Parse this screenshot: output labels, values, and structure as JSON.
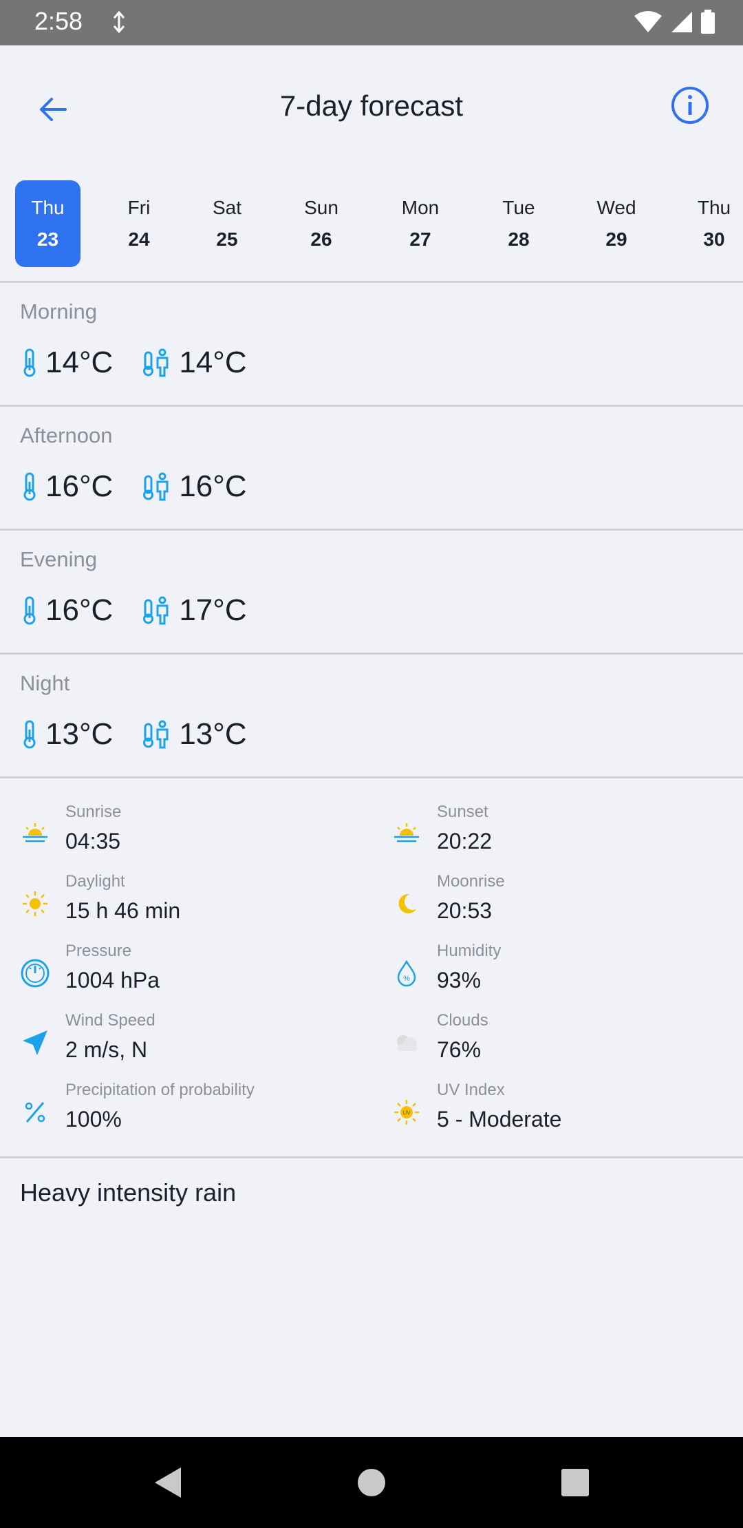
{
  "status_bar": {
    "time": "2:58"
  },
  "app_bar": {
    "title": "7-day forecast"
  },
  "days": [
    {
      "name": "Thu",
      "num": "23",
      "selected": true
    },
    {
      "name": "Fri",
      "num": "24"
    },
    {
      "name": "Sat",
      "num": "25"
    },
    {
      "name": "Sun",
      "num": "26"
    },
    {
      "name": "Mon",
      "num": "27"
    },
    {
      "name": "Tue",
      "num": "28"
    },
    {
      "name": "Wed",
      "num": "29"
    },
    {
      "name": "Thu",
      "num": "30"
    }
  ],
  "periods": [
    {
      "label": "Morning",
      "temp": "14°C",
      "feels_like": "14°C"
    },
    {
      "label": "Afternoon",
      "temp": "16°C",
      "feels_like": "16°C"
    },
    {
      "label": "Evening",
      "temp": "16°C",
      "feels_like": "17°C"
    },
    {
      "label": "Night",
      "temp": "13°C",
      "feels_like": "13°C"
    }
  ],
  "details": {
    "sunrise": {
      "label": "Sunrise",
      "value": "04:35",
      "icon": "sunrise-icon"
    },
    "sunset": {
      "label": "Sunset",
      "value": "20:22",
      "icon": "sunset-icon"
    },
    "daylight": {
      "label": "Daylight",
      "value": "15 h 46 min",
      "icon": "sun-icon"
    },
    "moonrise": {
      "label": "Moonrise",
      "value": "20:53",
      "icon": "moon-icon"
    },
    "pressure": {
      "label": "Pressure",
      "value": "1004 hPa",
      "icon": "gauge-icon"
    },
    "humidity": {
      "label": "Humidity",
      "value": "93%",
      "icon": "humidity-drop-icon"
    },
    "wind": {
      "label": "Wind Speed",
      "value": "2 m/s, N",
      "icon": "wind-direction-icon"
    },
    "clouds": {
      "label": "Clouds",
      "value": "76%",
      "icon": "cloud-icon"
    },
    "precipitation": {
      "label": "Precipitation of probability",
      "value": "100%",
      "icon": "percent-icon"
    },
    "uv": {
      "label": "UV Index",
      "value": "5 - Moderate",
      "icon": "uv-icon"
    }
  },
  "description": "Heavy intensity rain",
  "colors": {
    "accent": "#2f72ef",
    "icon_blue": "#1aa3e8",
    "icon_yellow": "#f2c200",
    "muted_text": "#8b8f99"
  }
}
